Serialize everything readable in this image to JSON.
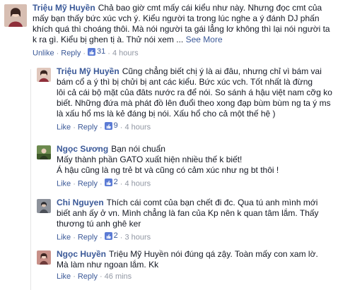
{
  "comments": [
    {
      "author": "Triệu Mỹ Huyền",
      "text": "Chả bao giờ cmt mấy cái kiểu như này. Nhưng đọc cmt của\nmấy bạn thấy bức xúc vch ý. Kiểu người ta trong lúc nghe a ý đánh DJ phấn\nkhích quá thì choáng thôi. Mà nói người ta gái lẳng lơ không thì lại nói người ta\nk ra gì. Kiểu bị ghen tị à. Thử nói xem ...",
      "see_more": "See More",
      "unlike": "Unlike",
      "reply": "Reply",
      "likes": "31",
      "time": "4 hours",
      "avatar_color": "#c9a79a"
    },
    {
      "author": "Triệu Mỹ Huyền",
      "text": "Cũng chẳng biết chị ý là ai đâu, nhưng chỉ vì bám vai\nbám cổ a ý thì bị chửi bị ant các kiểu. Bức xúc vch. Tốt nhất là đừng\nlôi cả cái bộ mặt của đâts nước ra để nói. So sánh á hậu việt nam cỡg ko\nbiết. Những đứa mà phát đồ lên đuổi theo xong đạp bùm bùm ng ta ý ms\nlà xấu hổ ms là kẻ đáng bị nói. Xấu hổ cho cả một thế hệ )",
      "like": "Like",
      "reply": "Reply",
      "likes": "9",
      "time": "4 hours",
      "avatar_color": "#c9a79a"
    },
    {
      "author": "Ngọc Sương",
      "text": "Bạn nói chuẩn\nMấy thành phần GATO xuất hiện nhiều thế k biết!\nÁ hậu cũng là ng trẻ bt và cũng có cảm xúc như ng bt thôi !",
      "like": "Like",
      "reply": "Reply",
      "likes": "2",
      "time": "4 hours",
      "avatar_color": "#4f6b3a"
    },
    {
      "author": "Chi Nguyen",
      "text": "Thích cái comt của bạn chết đi đc. Qua tú anh mình mới\nbiết anh ấy ở vn. Mình chẳng là fan của Kp nên k quan tâm lắm. Thấy\nthương tú anh ghê ker",
      "like": "Like",
      "reply": "Reply",
      "likes": "2",
      "time": "3 hours",
      "avatar_color": "#7a7f8a"
    },
    {
      "author": "Ngọc Huyền",
      "text": "Triệu Mỹ Huyền nói đúng qá zậy. Toàn mấy con xam lờ.\nMà làm như ngoan lắm. Kk",
      "like": "Like",
      "reply": "Reply",
      "time": "46 mins",
      "avatar_color": "#a86b63"
    }
  ],
  "colors": {
    "link": "#3b5998",
    "meta": "#9197a3",
    "text": "#141823"
  }
}
